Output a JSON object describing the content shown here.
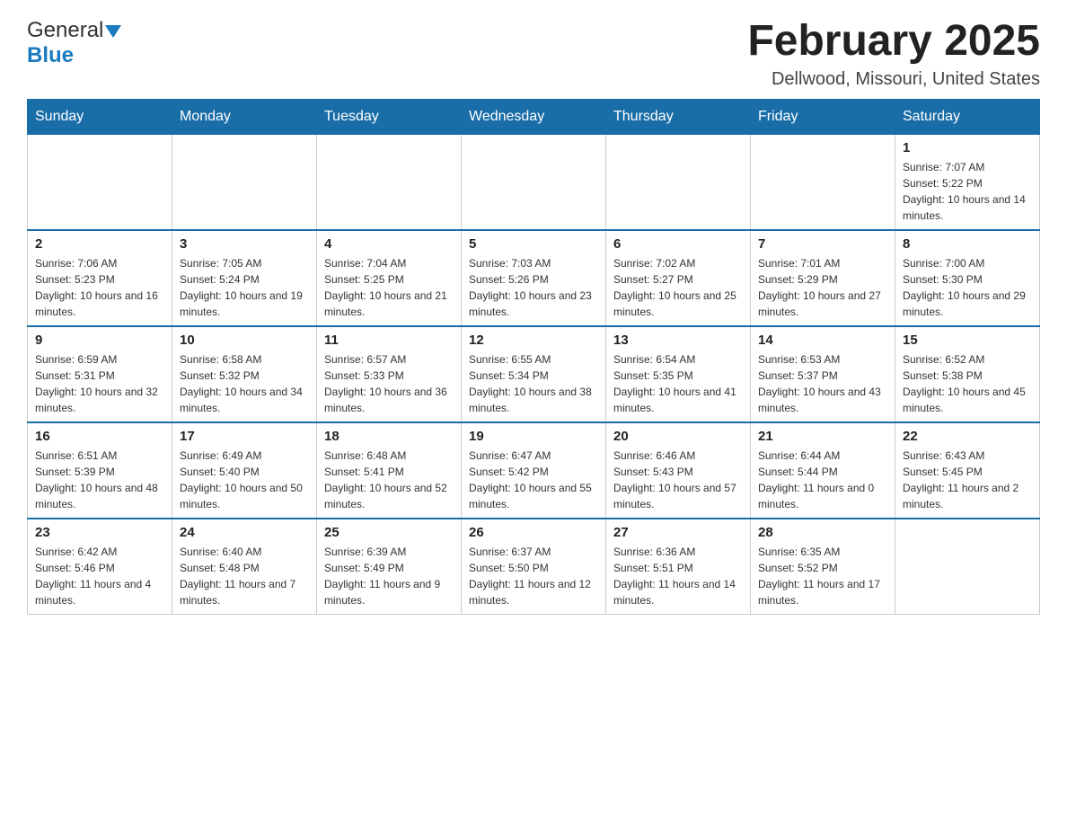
{
  "logo": {
    "general": "General",
    "blue": "Blue"
  },
  "title": "February 2025",
  "location": "Dellwood, Missouri, United States",
  "days_of_week": [
    "Sunday",
    "Monday",
    "Tuesday",
    "Wednesday",
    "Thursday",
    "Friday",
    "Saturday"
  ],
  "weeks": [
    [
      {
        "day": "",
        "info": ""
      },
      {
        "day": "",
        "info": ""
      },
      {
        "day": "",
        "info": ""
      },
      {
        "day": "",
        "info": ""
      },
      {
        "day": "",
        "info": ""
      },
      {
        "day": "",
        "info": ""
      },
      {
        "day": "1",
        "info": "Sunrise: 7:07 AM\nSunset: 5:22 PM\nDaylight: 10 hours and 14 minutes."
      }
    ],
    [
      {
        "day": "2",
        "info": "Sunrise: 7:06 AM\nSunset: 5:23 PM\nDaylight: 10 hours and 16 minutes."
      },
      {
        "day": "3",
        "info": "Sunrise: 7:05 AM\nSunset: 5:24 PM\nDaylight: 10 hours and 19 minutes."
      },
      {
        "day": "4",
        "info": "Sunrise: 7:04 AM\nSunset: 5:25 PM\nDaylight: 10 hours and 21 minutes."
      },
      {
        "day": "5",
        "info": "Sunrise: 7:03 AM\nSunset: 5:26 PM\nDaylight: 10 hours and 23 minutes."
      },
      {
        "day": "6",
        "info": "Sunrise: 7:02 AM\nSunset: 5:27 PM\nDaylight: 10 hours and 25 minutes."
      },
      {
        "day": "7",
        "info": "Sunrise: 7:01 AM\nSunset: 5:29 PM\nDaylight: 10 hours and 27 minutes."
      },
      {
        "day": "8",
        "info": "Sunrise: 7:00 AM\nSunset: 5:30 PM\nDaylight: 10 hours and 29 minutes."
      }
    ],
    [
      {
        "day": "9",
        "info": "Sunrise: 6:59 AM\nSunset: 5:31 PM\nDaylight: 10 hours and 32 minutes."
      },
      {
        "day": "10",
        "info": "Sunrise: 6:58 AM\nSunset: 5:32 PM\nDaylight: 10 hours and 34 minutes."
      },
      {
        "day": "11",
        "info": "Sunrise: 6:57 AM\nSunset: 5:33 PM\nDaylight: 10 hours and 36 minutes."
      },
      {
        "day": "12",
        "info": "Sunrise: 6:55 AM\nSunset: 5:34 PM\nDaylight: 10 hours and 38 minutes."
      },
      {
        "day": "13",
        "info": "Sunrise: 6:54 AM\nSunset: 5:35 PM\nDaylight: 10 hours and 41 minutes."
      },
      {
        "day": "14",
        "info": "Sunrise: 6:53 AM\nSunset: 5:37 PM\nDaylight: 10 hours and 43 minutes."
      },
      {
        "day": "15",
        "info": "Sunrise: 6:52 AM\nSunset: 5:38 PM\nDaylight: 10 hours and 45 minutes."
      }
    ],
    [
      {
        "day": "16",
        "info": "Sunrise: 6:51 AM\nSunset: 5:39 PM\nDaylight: 10 hours and 48 minutes."
      },
      {
        "day": "17",
        "info": "Sunrise: 6:49 AM\nSunset: 5:40 PM\nDaylight: 10 hours and 50 minutes."
      },
      {
        "day": "18",
        "info": "Sunrise: 6:48 AM\nSunset: 5:41 PM\nDaylight: 10 hours and 52 minutes."
      },
      {
        "day": "19",
        "info": "Sunrise: 6:47 AM\nSunset: 5:42 PM\nDaylight: 10 hours and 55 minutes."
      },
      {
        "day": "20",
        "info": "Sunrise: 6:46 AM\nSunset: 5:43 PM\nDaylight: 10 hours and 57 minutes."
      },
      {
        "day": "21",
        "info": "Sunrise: 6:44 AM\nSunset: 5:44 PM\nDaylight: 11 hours and 0 minutes."
      },
      {
        "day": "22",
        "info": "Sunrise: 6:43 AM\nSunset: 5:45 PM\nDaylight: 11 hours and 2 minutes."
      }
    ],
    [
      {
        "day": "23",
        "info": "Sunrise: 6:42 AM\nSunset: 5:46 PM\nDaylight: 11 hours and 4 minutes."
      },
      {
        "day": "24",
        "info": "Sunrise: 6:40 AM\nSunset: 5:48 PM\nDaylight: 11 hours and 7 minutes."
      },
      {
        "day": "25",
        "info": "Sunrise: 6:39 AM\nSunset: 5:49 PM\nDaylight: 11 hours and 9 minutes."
      },
      {
        "day": "26",
        "info": "Sunrise: 6:37 AM\nSunset: 5:50 PM\nDaylight: 11 hours and 12 minutes."
      },
      {
        "day": "27",
        "info": "Sunrise: 6:36 AM\nSunset: 5:51 PM\nDaylight: 11 hours and 14 minutes."
      },
      {
        "day": "28",
        "info": "Sunrise: 6:35 AM\nSunset: 5:52 PM\nDaylight: 11 hours and 17 minutes."
      },
      {
        "day": "",
        "info": ""
      }
    ]
  ]
}
